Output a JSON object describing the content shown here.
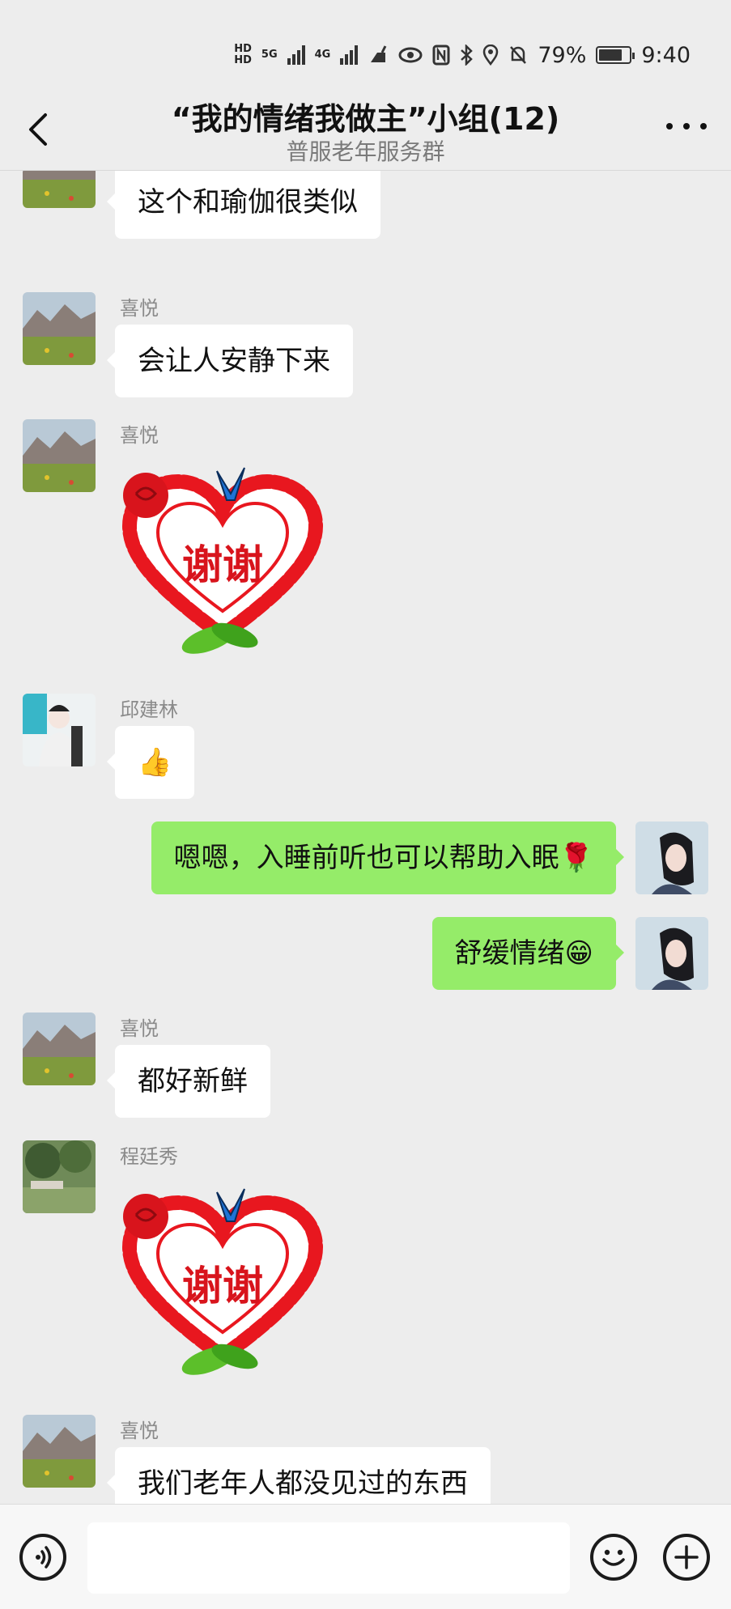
{
  "status_bar": {
    "hd1": "HD",
    "hd2": "HD",
    "net1": "5G",
    "net2": "4G",
    "battery_percent": "79%",
    "battery_level": 0.79,
    "time": "9:40"
  },
  "header": {
    "title": "“我的情绪我做主”小组(12)",
    "subtitle": "普服老年服务群"
  },
  "messages": [
    {
      "sender": "喜悦",
      "text": "这个和瑜伽很类似",
      "type": "text",
      "direction": "in"
    },
    {
      "sender": "喜悦",
      "text": "会让人安静下来",
      "type": "text",
      "direction": "in"
    },
    {
      "sender": "喜悦",
      "sticker_text": "谢谢",
      "type": "sticker",
      "direction": "in"
    },
    {
      "sender": "邱建林",
      "text": "👍",
      "type": "text",
      "direction": "in"
    },
    {
      "text": "嗯嗯，入睡前听也可以帮助入眠🌹",
      "type": "text",
      "direction": "out"
    },
    {
      "text": "舒缓情绪😁",
      "type": "text",
      "direction": "out"
    },
    {
      "sender": "喜悦",
      "text": "都好新鲜",
      "type": "text",
      "direction": "in"
    },
    {
      "sender": "程廷秀",
      "sticker_text": "谢谢",
      "type": "sticker",
      "direction": "in"
    },
    {
      "sender": "喜悦",
      "text": "我们老年人都没见过的东西",
      "type": "text",
      "direction": "in"
    }
  ],
  "icons": {
    "back": "chevron-left-icon",
    "more": "more-dots-icon",
    "voice": "voice-icon",
    "emoji": "emoji-icon",
    "plus": "plus-icon"
  },
  "colors": {
    "background": "#ededed",
    "incoming_bubble": "#ffffff",
    "outgoing_bubble": "#95ec69"
  }
}
